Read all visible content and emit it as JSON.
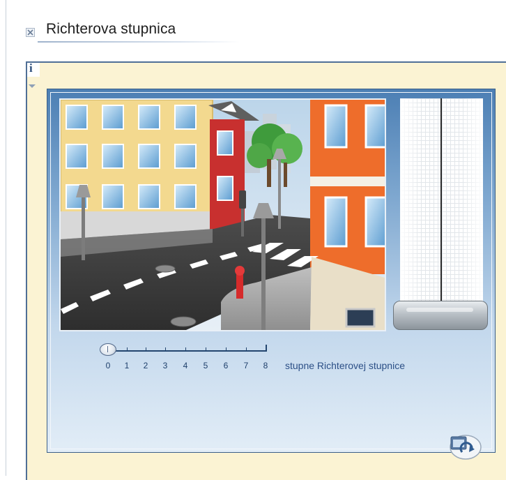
{
  "window": {
    "title": "Richterova stupnica"
  },
  "info": {
    "label": "i"
  },
  "slider": {
    "value": 0,
    "ticks": [
      "0",
      "1",
      "2",
      "3",
      "4",
      "5",
      "6",
      "7",
      "8"
    ],
    "caption": "stupne Richterovej stupnice"
  },
  "icons": {
    "close": "close-icon",
    "info": "info-icon",
    "collapse": "chevron-down-icon",
    "reset": "refresh-icon"
  },
  "colors": {
    "accent": "#4f6f96",
    "panel_bg": "#fbf3d3",
    "frame_top": "#4c7fb4",
    "caption": "#2b4f86"
  }
}
